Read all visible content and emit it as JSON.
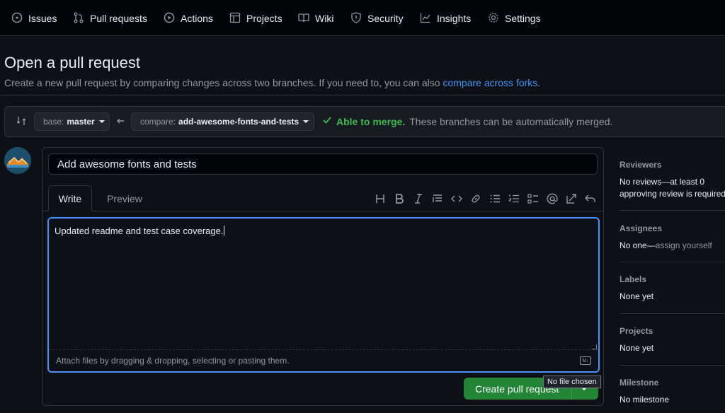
{
  "nav": {
    "items": [
      {
        "label": "Issues",
        "icon": "issue-icon"
      },
      {
        "label": "Pull requests",
        "icon": "pull-request-icon"
      },
      {
        "label": "Actions",
        "icon": "play-icon"
      },
      {
        "label": "Projects",
        "icon": "table-icon"
      },
      {
        "label": "Wiki",
        "icon": "book-icon"
      },
      {
        "label": "Security",
        "icon": "shield-icon"
      },
      {
        "label": "Insights",
        "icon": "graph-icon"
      },
      {
        "label": "Settings",
        "icon": "gear-icon"
      }
    ]
  },
  "page": {
    "title": "Open a pull request",
    "subtitle": "Create a new pull request by comparing changes across two branches. If you need to, you can also",
    "subtitle_link": "compare across forks",
    "subtitle_end": "."
  },
  "compare": {
    "base_prefix": "base:",
    "base_branch": "master",
    "compare_prefix": "compare:",
    "compare_branch": "add-awesome-fonts-and-tests",
    "merge_status_bold": "Able to merge.",
    "merge_status_text": "These branches can be automatically merged."
  },
  "form": {
    "title_value": "Add awesome fonts and tests",
    "tab_write": "Write",
    "tab_preview": "Preview",
    "toolbar": [
      "heading-icon",
      "bold-icon",
      "italic-icon",
      "quote-icon",
      "code-icon",
      "link-icon",
      "bulleted-list-icon",
      "numbered-list-icon",
      "task-list-icon",
      "mention-icon",
      "cross-reference-icon",
      "undo-icon"
    ],
    "body_value": "Updated readme and test case coverage.",
    "attach_text": "Attach files by dragging & dropping, selecting or pasting them.",
    "create_button": "Create pull request",
    "tooltip": "No file chosen"
  },
  "sidebar": {
    "reviewers_heading": "Reviewers",
    "reviewers_value": "No reviews—at least 0 approving review is required.",
    "assignees_heading": "Assignees",
    "assignees_value": "No one—",
    "assignees_link": "assign yourself",
    "labels_heading": "Labels",
    "labels_value": "None yet",
    "projects_heading": "Projects",
    "projects_value": "None yet",
    "milestone_heading": "Milestone",
    "milestone_value": "No milestone"
  },
  "colors": {
    "background": "#0d1117",
    "accent_blue": "#4493f8",
    "success_green": "#3fb950",
    "button_green": "#238636"
  }
}
